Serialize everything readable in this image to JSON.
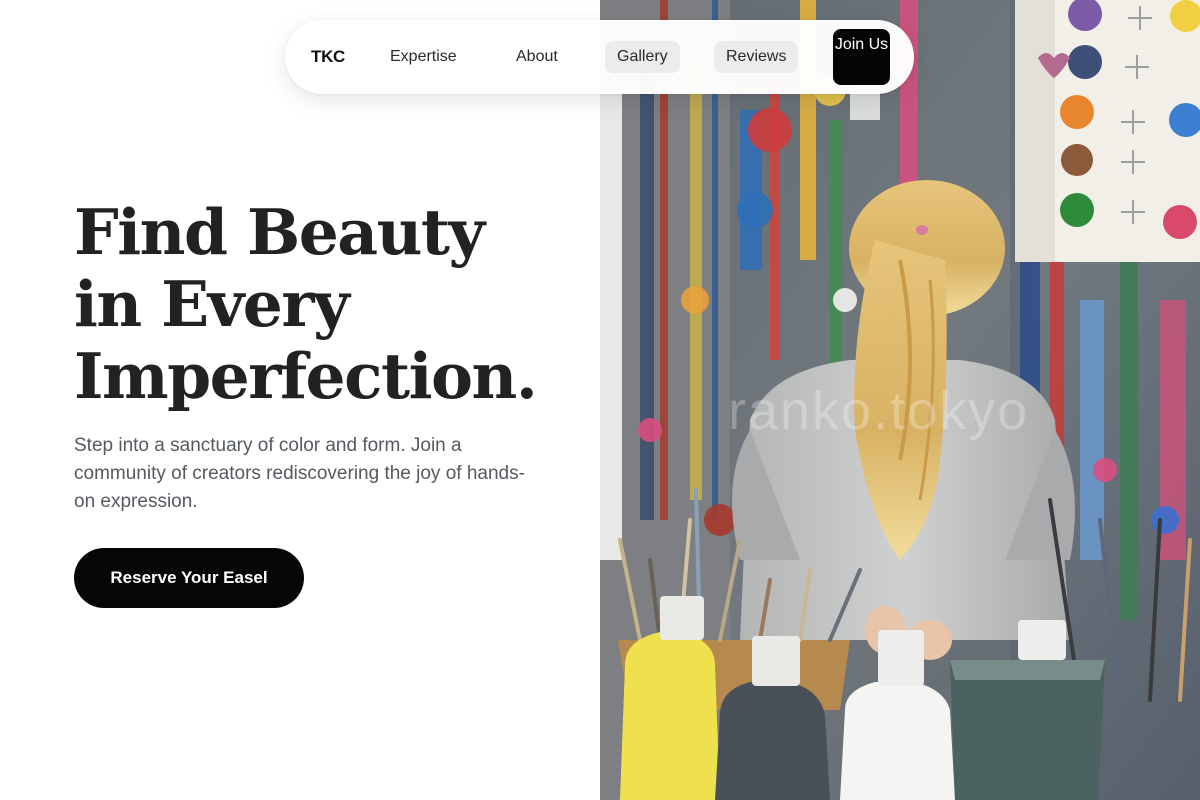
{
  "nav": {
    "logo": "TKC",
    "links": [
      {
        "label": "Expertise",
        "highlighted": false
      },
      {
        "label": "About",
        "highlighted": false
      },
      {
        "label": "Gallery",
        "highlighted": true
      },
      {
        "label": "Reviews",
        "highlighted": true
      }
    ],
    "join_label": "Join Us"
  },
  "hero": {
    "title_lines": [
      "Find Beauty",
      "in Every",
      "Imperfection."
    ],
    "subtitle": "Step into a sanctuary of color and form. Join a community of creators rediscovering the joy of hands-on expression.",
    "cta_label": "Reserve Your Easel"
  },
  "photo": {
    "subject": "child-in-paint-studio-photo",
    "watermark": "ranko.tokyo"
  },
  "colors": {
    "page_bg": "#ffffff",
    "title": "#222222",
    "subtitle": "#555a60",
    "cta_bg": "#060606",
    "pill_bg": "#ececec"
  }
}
